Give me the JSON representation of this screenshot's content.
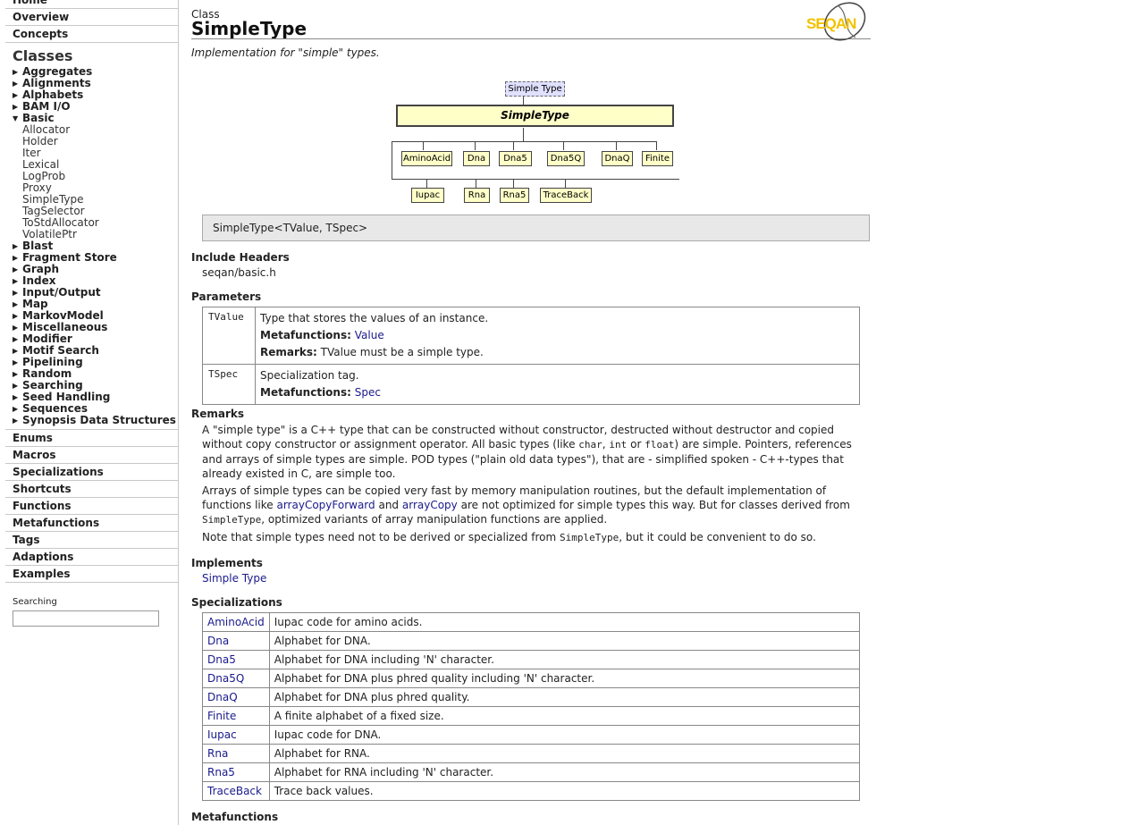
{
  "sidebar": {
    "top_items": [
      "Home",
      "Overview",
      "Concepts"
    ],
    "classes_heading": "Classes",
    "classes_before": [
      "Aggregates",
      "Alignments",
      "Alphabets",
      "BAM I/O"
    ],
    "basic": {
      "label": "Basic",
      "children": [
        "Allocator",
        "Holder",
        "Iter",
        "Lexical",
        "LogProb",
        "Proxy",
        "SimpleType",
        "TagSelector",
        "ToStdAllocator",
        "VolatilePtr"
      ]
    },
    "classes_after": [
      "Blast",
      "Fragment Store",
      "Graph",
      "Index",
      "Input/Output",
      "Map",
      "MarkovModel",
      "Miscellaneous",
      "Modifier",
      "Motif Search",
      "Pipelining",
      "Random",
      "Searching",
      "Seed Handling",
      "Sequences",
      "Synopsis Data Structures"
    ],
    "bottom_items": [
      "Enums",
      "Macros",
      "Specializations",
      "Shortcuts",
      "Functions",
      "Metafunctions",
      "Tags",
      "Adaptions",
      "Examples"
    ],
    "search_label": "Searching",
    "search_value": ""
  },
  "header": {
    "kind": "Class",
    "title": "SimpleType",
    "logo_text": "SEQAN",
    "summary": "Implementation for \"simple\" types."
  },
  "diagram": {
    "concept": "Simple Type",
    "main": "SimpleType",
    "row1": [
      "AminoAcid",
      "Dna",
      "Dna5",
      "Dna5Q",
      "DnaQ",
      "Finite"
    ],
    "row2": [
      "Iupac",
      "Rna",
      "Rna5",
      "TraceBack"
    ]
  },
  "signature": "SimpleType<TValue, TSpec>",
  "include": {
    "heading": "Include Headers",
    "value": "seqan/basic.h"
  },
  "parameters": {
    "heading": "Parameters",
    "metafunctions_label": "Metafunctions:",
    "remarks_label": "Remarks:",
    "rows": [
      {
        "name": "TValue",
        "desc": "Type that stores the values of an instance.",
        "metafunction": "Value",
        "remark": "TValue must be a simple type."
      },
      {
        "name": "TSpec",
        "desc": "Specialization tag.",
        "metafunction": "Spec"
      }
    ]
  },
  "remarks": {
    "heading": "Remarks",
    "p1_a": "A \"simple type\" is a C++ type that can be constructed without constructor, destructed without destructor and copied without copy constructor or assignment operator. All basic types (like ",
    "p1_char": "char",
    "p1_sep1": ", ",
    "p1_int": "int",
    "p1_or": " or ",
    "p1_float": "float",
    "p1_b": ") are simple. Pointers, references and arrays of simple types are simple. POD types (\"plain old data types\"), that are - simplified spoken - C++-types that already existed in C, are simple too.",
    "p2_a": "Arrays of simple types can be copied very fast by memory manipulation routines, but the default implementation of functions like ",
    "p2_link1": "arrayCopyForward",
    "p2_and": " and ",
    "p2_link2": "arrayCopy",
    "p2_b": " are not optimized for simple types this way. But for classes derived from ",
    "p2_code": "SimpleType",
    "p2_c": ", optimized variants of array manipulation functions are applied.",
    "p3_a": "Note that simple types need not to be derived or specialized from ",
    "p3_code": "SimpleType",
    "p3_b": ", but it could be convenient to do so."
  },
  "implements": {
    "heading": "Implements",
    "link": "Simple Type"
  },
  "specializations": {
    "heading": "Specializations",
    "rows": [
      {
        "name": "AminoAcid",
        "desc": "Iupac code for amino acids."
      },
      {
        "name": "Dna",
        "desc": "Alphabet for DNA."
      },
      {
        "name": "Dna5",
        "desc": "Alphabet for DNA including 'N' character."
      },
      {
        "name": "Dna5Q",
        "desc": "Alphabet for DNA plus phred quality including 'N' character."
      },
      {
        "name": "DnaQ",
        "desc": "Alphabet for DNA plus phred quality."
      },
      {
        "name": "Finite",
        "desc": "A finite alphabet of a fixed size."
      },
      {
        "name": "Iupac",
        "desc": "Iupac code for DNA."
      },
      {
        "name": "Rna",
        "desc": "Alphabet for RNA."
      },
      {
        "name": "Rna5",
        "desc": "Alphabet for RNA including 'N' character."
      },
      {
        "name": "TraceBack",
        "desc": "Trace back values."
      }
    ]
  },
  "metafunctions_heading": "Metafunctions",
  "colors": {
    "link": "#1a1a8c",
    "diagram_box": "#ffffc8",
    "concept_box": "#e0e0ff",
    "signature_bg": "#e8e8e8",
    "logo_yellow": "#f2c200"
  }
}
